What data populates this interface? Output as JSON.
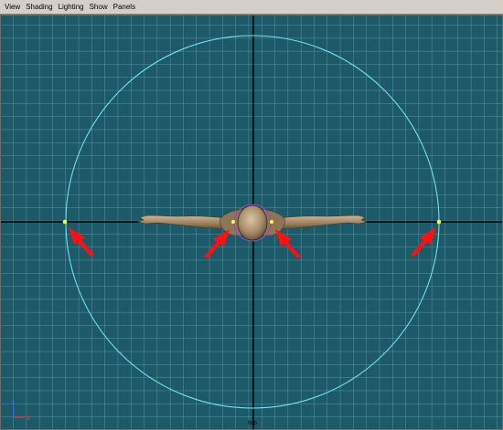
{
  "menubar": {
    "items": [
      {
        "label": "View"
      },
      {
        "label": "Shading"
      },
      {
        "label": "Lighting"
      },
      {
        "label": "Show"
      },
      {
        "label": "Panels"
      }
    ]
  },
  "viewport": {
    "background_color": "#1c5a6a",
    "grid_color": "#6fa7b3",
    "axis_line_color": "#000000",
    "circle_color": "#6fe1f1",
    "control_point_color": "#ffff33",
    "arrow_color": "#ff1010",
    "skin_color": "#b39a7a",
    "camera_label": "top",
    "axis_gizmo": {
      "x_label": "x",
      "z_label": "z",
      "x_color": "#ff3030",
      "z_color": "#3060ff"
    }
  }
}
